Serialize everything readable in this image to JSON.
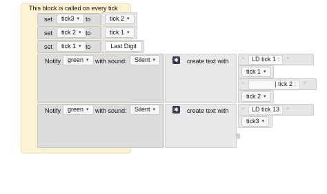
{
  "hat": {
    "title": "This block is called on every tick"
  },
  "rows": [
    {
      "set_label": "set",
      "var": "tick3",
      "to_label": "to",
      "value": "tick 2"
    },
    {
      "set_label": "set",
      "var": "tick 2",
      "to_label": "to",
      "value": "tick 1"
    },
    {
      "set_label": "set",
      "var": "tick 1",
      "to_label": "to",
      "value": "Last Digit"
    }
  ],
  "notify1": {
    "notify_label": "Notify",
    "color": "green",
    "sound_label": "with sound:",
    "sound": "Silent",
    "create_label": "create text with",
    "parts": [
      "LD tick 1 :",
      "tick 1",
      "| tick 2 :",
      "tick 2"
    ]
  },
  "notify2": {
    "notify_label": "Notify",
    "color": "green",
    "sound_label": "with sound:",
    "sound": "Silent",
    "create_label": "create text with",
    "parts": [
      "LD tick 13",
      "tick3"
    ]
  },
  "symbols": {
    "caret": "▾",
    "open_quote": "“",
    "close_quote": "”",
    "mutator_icon": "gear-icon",
    "mutator_glyph": "✱"
  }
}
